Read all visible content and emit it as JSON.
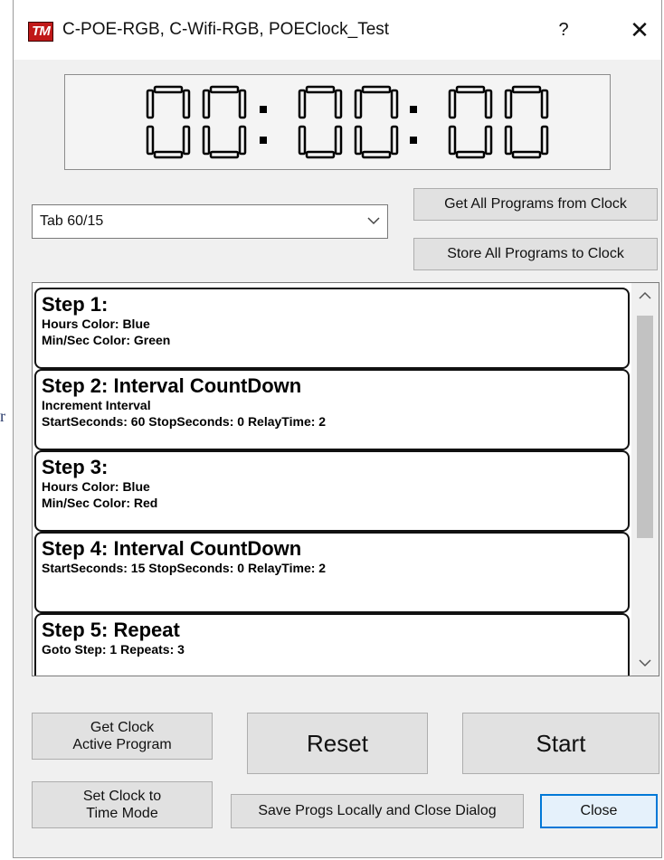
{
  "window": {
    "title": "C-POE-RGB, C-Wifi-RGB, POEClock_Test",
    "logo_text": "TM",
    "help_label": "?",
    "close_label": "✕"
  },
  "clock": {
    "display": "00:00:00",
    "digits": [
      "0",
      "0",
      "0",
      "0",
      "0",
      "0"
    ]
  },
  "program_select": {
    "selected": "Tab 60/15"
  },
  "buttons": {
    "get_all": "Get All Programs from Clock",
    "store_all": "Store All Programs to Clock",
    "get_active_line1": "Get Clock",
    "get_active_line2": "Active Program",
    "reset": "Reset",
    "start": "Start",
    "set_time_line1": "Set Clock to",
    "set_time_line2": "Time Mode",
    "save_close": "Save Progs Locally and Close Dialog",
    "close": "Close"
  },
  "steps": [
    {
      "title": "Step 1:",
      "lines": [
        "Hours Color: Blue",
        "Min/Sec Color: Green"
      ]
    },
    {
      "title": "Step 2: Interval CountDown",
      "lines": [
        "Increment Interval",
        "StartSeconds: 60  StopSeconds: 0 RelayTime: 2"
      ]
    },
    {
      "title": "Step 3:",
      "lines": [
        "Hours Color: Blue",
        "Min/Sec Color: Red"
      ]
    },
    {
      "title": "Step 4: Interval CountDown",
      "lines": [
        "StartSeconds: 15  StopSeconds: 0 RelayTime: 2"
      ]
    },
    {
      "title": "Step 5: Repeat",
      "lines": [
        "Goto Step: 1  Repeats: 3"
      ]
    }
  ],
  "stray_text": "r",
  "icons": {
    "combo_arrow": "chevron-down-icon",
    "scroll_up": "chevron-up-icon",
    "scroll_down": "chevron-down-icon"
  },
  "colors": {
    "logo": "#c01818",
    "focus_border": "#0078d7",
    "segment_on": "#000000"
  }
}
